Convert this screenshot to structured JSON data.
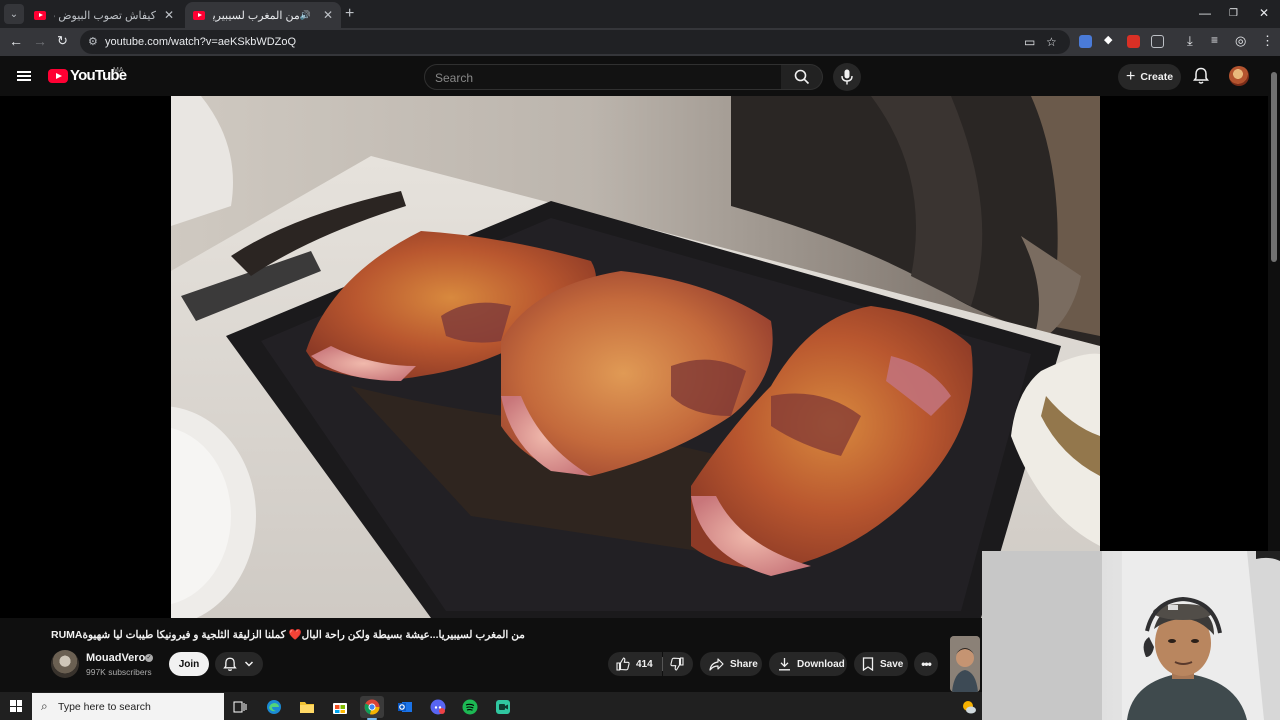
{
  "browser": {
    "tabs": [
      {
        "title": "كيفاش تصوب البيوض ب الاعشاب",
        "active": false
      },
      {
        "title": "من المغرب لسيبيريا...عيشة بـ",
        "active": true
      }
    ],
    "new_tab_label": "+",
    "url": "youtube.com/watch?v=aeKSkbWDZoQ"
  },
  "youtube": {
    "logo_text": "YouTube",
    "country_code": "MA",
    "search_placeholder": "Search",
    "create_label": "Create",
    "accent_color": "#ff0033"
  },
  "video": {
    "title": "من المغرب لسيبيريا...عيشة بسيطة ولكن راحة البال❤️ كملنا الزليقة الثلجية و فيرونيكا طيبات ليا شهيوةRUMA",
    "channel_name": "MouadVero",
    "subscribers": "997K subscribers",
    "join_label": "Join",
    "likes": "414",
    "share_label": "Share",
    "download_label": "Download",
    "save_label": "Save"
  },
  "taskbar": {
    "search_placeholder": "Type here to search",
    "apps": [
      "task-view",
      "edge",
      "file-explorer",
      "store",
      "chrome",
      "outlook",
      "discord",
      "spotify",
      "camera-app"
    ]
  }
}
